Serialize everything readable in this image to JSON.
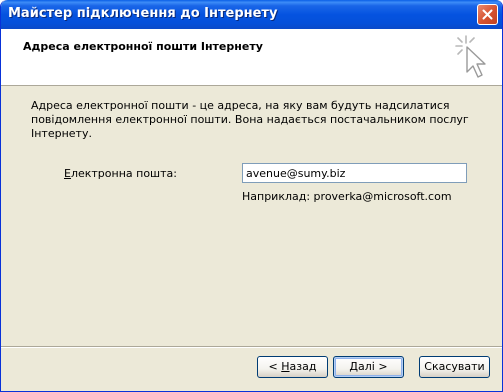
{
  "window": {
    "title": "Майстер підключення до Інтернету",
    "close_icon": "close-icon"
  },
  "header": {
    "title": "Адреса електронної пошти Інтернету",
    "icon": "wizard-sparkle-cursor-icon"
  },
  "body": {
    "description": "Адреса електронної пошти - це адреса, на яку вам будуть надсилатися повідомлення електронної пошти. Вона надається постачальником послуг Інтернету.",
    "email_label_access_key": "Е",
    "email_label_rest": "лектронна пошта:",
    "email_value": "avenue@sumy.biz",
    "example": "Наприклад: proverka@microsoft.com"
  },
  "buttons": {
    "back_prefix": "< ",
    "back_key": "Н",
    "back_rest": "азад",
    "next_prefix": "",
    "next_key": "Д",
    "next_rest": "алі >",
    "cancel": "Скасувати"
  },
  "colors": {
    "titlebar": "#0553e0",
    "dialog_bg": "#ece9d8",
    "header_bg": "#ffffff",
    "input_border": "#7f9db9",
    "close_button": "#d5512f"
  }
}
